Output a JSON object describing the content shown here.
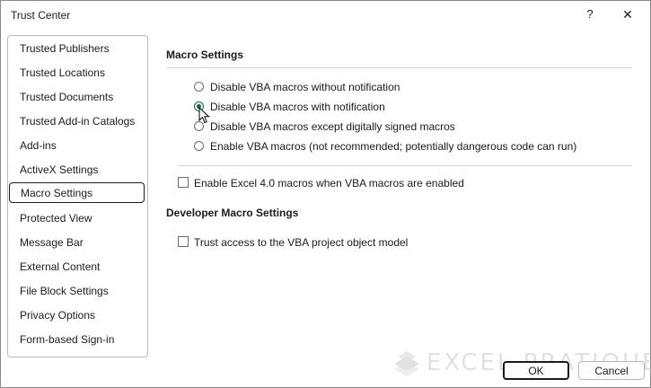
{
  "window": {
    "title": "Trust Center",
    "help_glyph": "?",
    "close_glyph": "✕"
  },
  "sidebar": {
    "items": [
      {
        "label": "Trusted Publishers"
      },
      {
        "label": "Trusted Locations"
      },
      {
        "label": "Trusted Documents"
      },
      {
        "label": "Trusted Add-in Catalogs"
      },
      {
        "label": "Add-ins"
      },
      {
        "label": "ActiveX Settings"
      },
      {
        "label": "Macro Settings",
        "selected": true
      },
      {
        "label": "Protected View"
      },
      {
        "label": "Message Bar"
      },
      {
        "label": "External Content"
      },
      {
        "label": "File Block Settings"
      },
      {
        "label": "Privacy Options"
      },
      {
        "label": "Form-based Sign-in"
      }
    ]
  },
  "macro_settings": {
    "heading": "Macro Settings",
    "options": [
      {
        "label": "Disable VBA macros without notification",
        "checked": false
      },
      {
        "label": "Disable VBA macros with notification",
        "checked": true
      },
      {
        "label": "Disable VBA macros except digitally signed macros",
        "checked": false
      },
      {
        "label": "Enable VBA macros (not recommended; potentially dangerous code can run)",
        "checked": false
      }
    ],
    "excel4_checkbox": {
      "label": "Enable Excel 4.0 macros when VBA macros are enabled",
      "checked": false
    }
  },
  "developer_settings": {
    "heading": "Developer Macro Settings",
    "trust_checkbox": {
      "label": "Trust access to the VBA project object model",
      "checked": false
    }
  },
  "buttons": {
    "ok": "OK",
    "cancel": "Cancel"
  },
  "watermark": {
    "text": "EXCEL PRATIQUE"
  },
  "colors": {
    "accent": "#0f6c3a",
    "border": "#b9b9b9"
  }
}
